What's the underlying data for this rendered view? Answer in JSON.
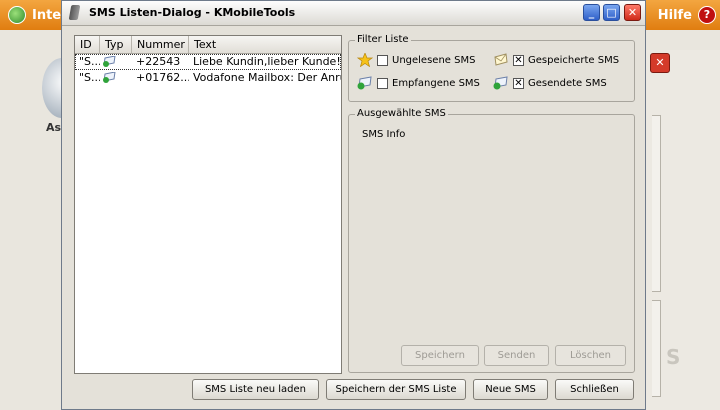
{
  "background_app": {
    "left_label": "Inte",
    "help_label": "Hilfe",
    "help_icon_glyph": "?",
    "side_text": "As",
    "close_glyph": "✕",
    "logo_text": "S"
  },
  "dialog": {
    "title": "SMS Listen-Dialog - KMobileTools",
    "window_buttons": {
      "minimize": "_",
      "maximize": "□",
      "close": "✕"
    }
  },
  "list": {
    "columns": [
      "ID",
      "Typ",
      "Nummer",
      "Text"
    ],
    "rows": [
      {
        "id": "\"S...",
        "number": "+22543",
        "text": "Liebe Kundin,lieber Kunde! ...",
        "icon": "sms-sent-icon"
      },
      {
        "id": "\"S...",
        "number": "+01762...",
        "text": "Vodafone Mailbox: Der Anru...",
        "icon": "sms-sent-icon"
      }
    ]
  },
  "filter": {
    "title": "Filter Liste",
    "unread": {
      "label": "Ungelesene SMS",
      "checked": false,
      "icon": "star-icon"
    },
    "saved": {
      "label": "Gespeicherte SMS",
      "checked": true,
      "icon": "saved-sms-icon"
    },
    "received": {
      "label": "Empfangene SMS",
      "checked": false,
      "icon": "received-sms-icon"
    },
    "sent": {
      "label": "Gesendete SMS",
      "checked": true,
      "icon": "sent-sms-icon"
    }
  },
  "selected_sms": {
    "title": "Ausgewählte SMS",
    "info": "SMS Info",
    "buttons": {
      "save": "Speichern",
      "send": "Senden",
      "delete": "Löschen"
    }
  },
  "bottom_buttons": {
    "reload": "SMS Liste neu laden",
    "save_list": "Speichern der SMS Liste",
    "new_sms": "Neue SMS",
    "close": "Schließen"
  },
  "colors": {
    "accent_orange": "#e07d10",
    "window_close_red": "#cf2a1a",
    "window_button_blue": "#2f5fc8"
  }
}
